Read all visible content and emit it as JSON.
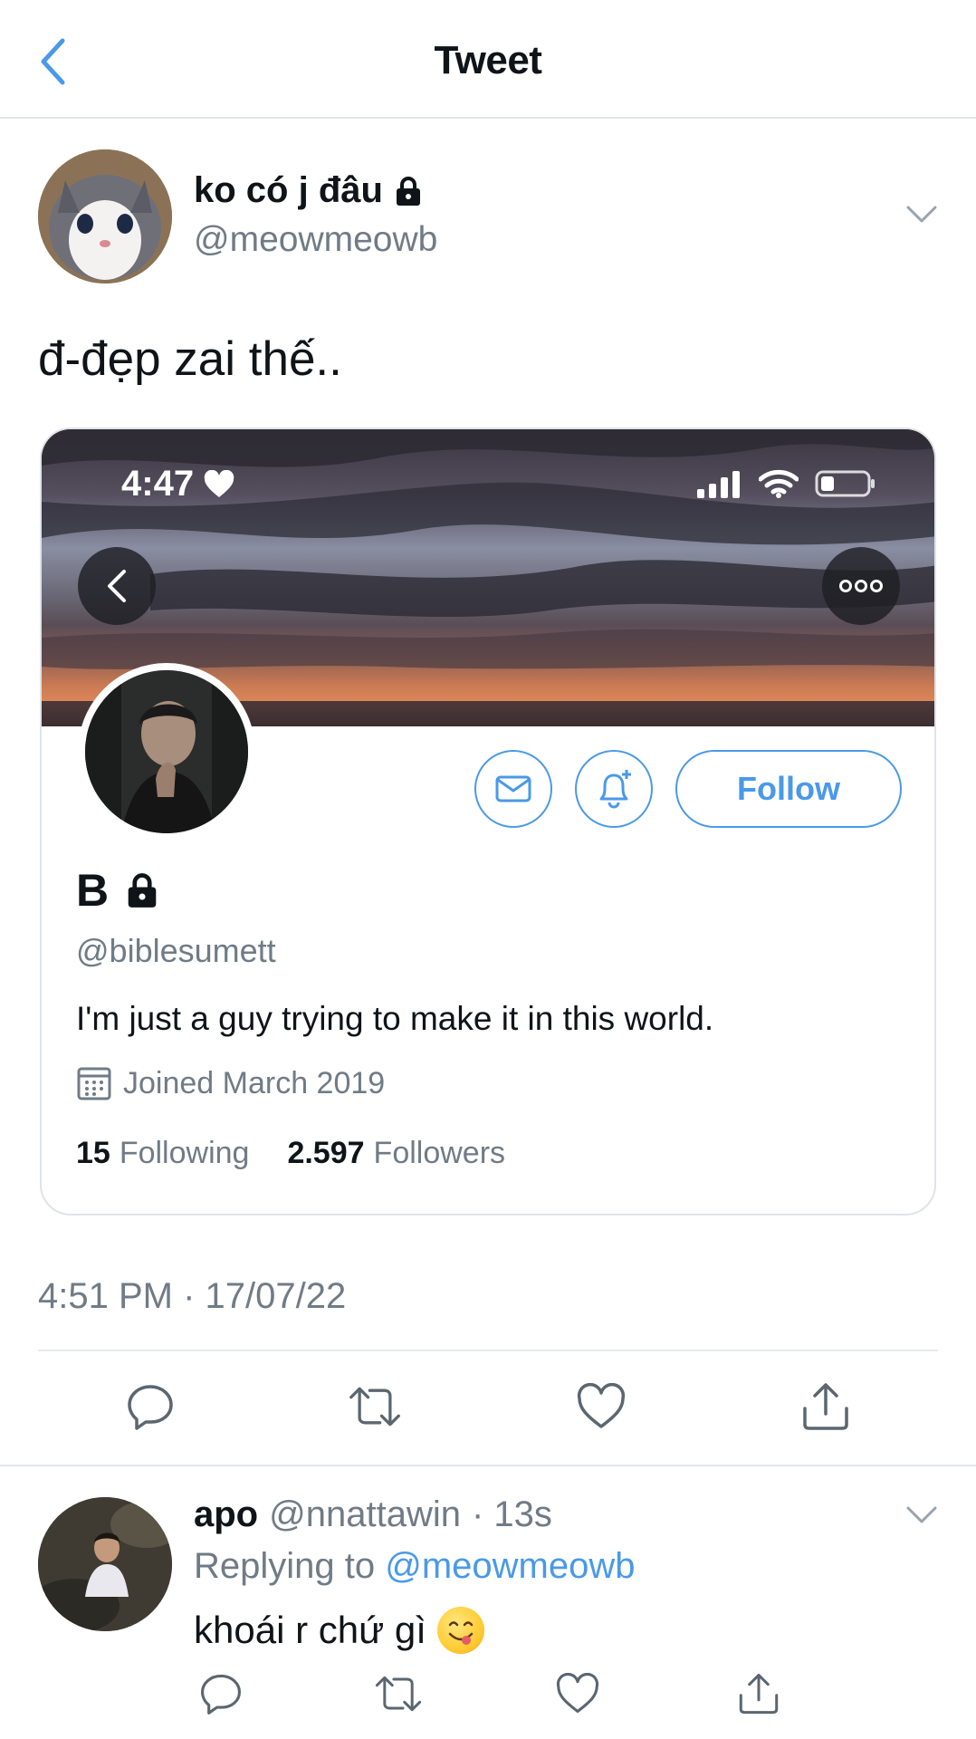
{
  "header": {
    "title": "Tweet",
    "back_icon": "chevron-left-icon"
  },
  "tweet": {
    "author_name": "ko có j đâu",
    "author_handle": "@meowmeowb",
    "text": "đ-đẹp zai thế..",
    "timestamp": "4:51 PM · 17/07/22"
  },
  "card": {
    "status_time": "4:47",
    "name": "B",
    "handle": "@biblesumett",
    "bio": "I'm just a guy trying to make it in this world.",
    "joined": "Joined March 2019",
    "following_count": "15",
    "following_label": "Following",
    "followers_count": "2.597",
    "followers_label": "Followers",
    "follow_label": "Follow"
  },
  "reply": {
    "name": "apo",
    "handle": "@nnattawin",
    "time": "· 13s",
    "replying_label": "Replying to",
    "replying_mention": "@meowmeowb",
    "text": "khoái r chứ gì"
  },
  "colors": {
    "accent": "#4a99e9",
    "secondary_text": "#707b86",
    "primary_text": "#0f1419",
    "divider": "#e1e4e8"
  }
}
